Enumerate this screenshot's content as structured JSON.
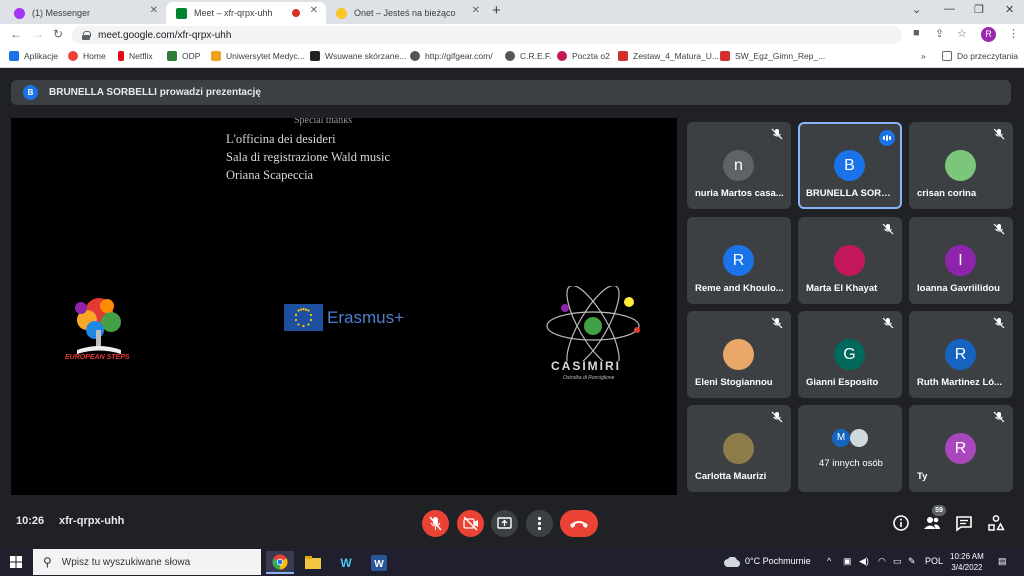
{
  "browser": {
    "tabs": [
      {
        "title": "(1) Messenger",
        "color": "#a334fa"
      },
      {
        "title": "Meet – xfr-qrpx-uhh",
        "color": "#00832d"
      },
      {
        "title": "Onet – Jesteś na bieżąco",
        "color": "#f9c623"
      }
    ],
    "new_tab": "+",
    "url": "meet.google.com/xfr-qrpx-uhh",
    "profile_initial": "R",
    "bookmarks": [
      {
        "label": "Aplikacje",
        "color": "#1a73e8"
      },
      {
        "label": "Home",
        "color": "#ea4335"
      },
      {
        "label": "Netflix",
        "color": "#e50914"
      },
      {
        "label": "ODP",
        "color": "#2e7d32"
      },
      {
        "label": "Uniwersytet Medyc...",
        "color": "#f4a21d"
      },
      {
        "label": "Wsuwane skórzane...",
        "color": "#222222"
      },
      {
        "label": "http://gifgear.com/",
        "color": "#555555"
      },
      {
        "label": "C.R.E.F.",
        "color": "#555555"
      },
      {
        "label": "Poczta o2",
        "color": "#c2185b"
      },
      {
        "label": "Zestaw_4_Matura_U...",
        "color": "#d32f2f"
      },
      {
        "label": "SW_Egz_Gimn_Rep_...",
        "color": "#d32f2f"
      }
    ],
    "more_bookmarks": "»",
    "reading_list": "Do przeczytania"
  },
  "meet": {
    "banner": {
      "initial": "B",
      "text": "BRUNELLA SORBELLI prowadzi prezentację"
    },
    "presentation": {
      "credits_partial": "Special thanks",
      "credits": [
        "L'officina dei desideri",
        "Sala di registrazione Wald music",
        "Oriana Scapeccia"
      ],
      "logo_left": "EUROPEAN STEPS",
      "logo_center": "Erasmus+",
      "logo_right": "CASIMIRI",
      "logo_right_sub": "Ostrolka di Ronciglione"
    },
    "participants": [
      {
        "name": "nuria Martos casa...",
        "initial": "n",
        "color": "#5f6368",
        "muted": true
      },
      {
        "name": "BRUNELLA SORBE...",
        "initial": "B",
        "color": "#1a73e8",
        "muted": false
      },
      {
        "name": "crisan corina",
        "initial": "",
        "color": "#7bc67b",
        "muted": true
      },
      {
        "name": "Reme and Khoulo...",
        "initial": "R",
        "color": "#1a73e8",
        "muted": false
      },
      {
        "name": "Marta El Khayat",
        "initial": "",
        "color": "#c2185b",
        "muted": true
      },
      {
        "name": "Ioanna Gavriilidou",
        "initial": "I",
        "color": "#8e24aa",
        "muted": true
      },
      {
        "name": "Eleni Stogiannou",
        "initial": "",
        "color": "#e9a86a",
        "muted": true
      },
      {
        "name": "Gianni Esposito",
        "initial": "G",
        "color": "#00695c",
        "muted": true
      },
      {
        "name": "Ruth Martinez Ló...",
        "initial": "R",
        "color": "#1565c0",
        "muted": true
      },
      {
        "name": "Carlotta Maurizi",
        "initial": "",
        "color": "#8d7b4a",
        "muted": true
      },
      {
        "name": "47 innych osób",
        "initial": "M",
        "color": "#1565c0",
        "muted": false
      },
      {
        "name": "Ty",
        "initial": "R",
        "color": "#ab47bc",
        "muted": true
      }
    ],
    "bottom": {
      "time": "10:26",
      "code": "xfr-qrpx-uhh",
      "people_count": "59"
    }
  },
  "taskbar": {
    "search_placeholder": "Wpisz tu wyszukiwane słowa",
    "weather": "0°C Pochmurnie",
    "language": "POL",
    "time": "10:26 AM",
    "date": "3/4/2022"
  }
}
